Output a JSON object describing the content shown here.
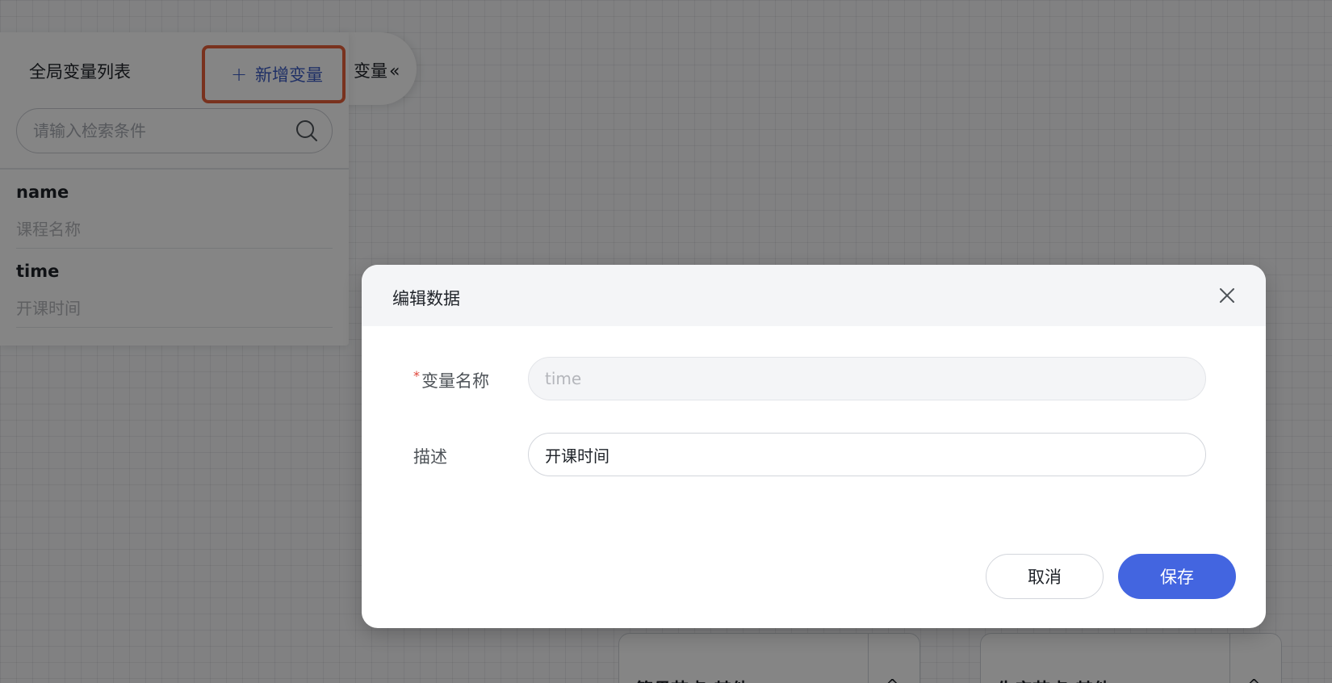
{
  "variable_panel": {
    "title": "全局变量列表",
    "add_button_label": "新增变量",
    "tab_label": "变量",
    "tab_chevron": "«",
    "search_placeholder": "请输入检索条件",
    "items": [
      {
        "name": "name",
        "description": "课程名称"
      },
      {
        "name": "time",
        "description": "开课时间"
      }
    ]
  },
  "dialog": {
    "title": "编辑数据",
    "fields": {
      "name_label": "变量名称",
      "name_required_mark": "*",
      "name_value": "time",
      "description_label": "描述",
      "description_value": "开课时间"
    },
    "buttons": {
      "cancel": "取消",
      "save": "保存"
    }
  },
  "canvas_nodes": [
    {
      "title": "籍贯节点-其他",
      "toggle": "^"
    },
    {
      "title": "生产节点-其他",
      "toggle": "^"
    }
  ],
  "colors": {
    "primary": "#4365e0",
    "link": "#3d5cc4",
    "highlight_border": "#e8613a",
    "required": "#e0453a"
  }
}
